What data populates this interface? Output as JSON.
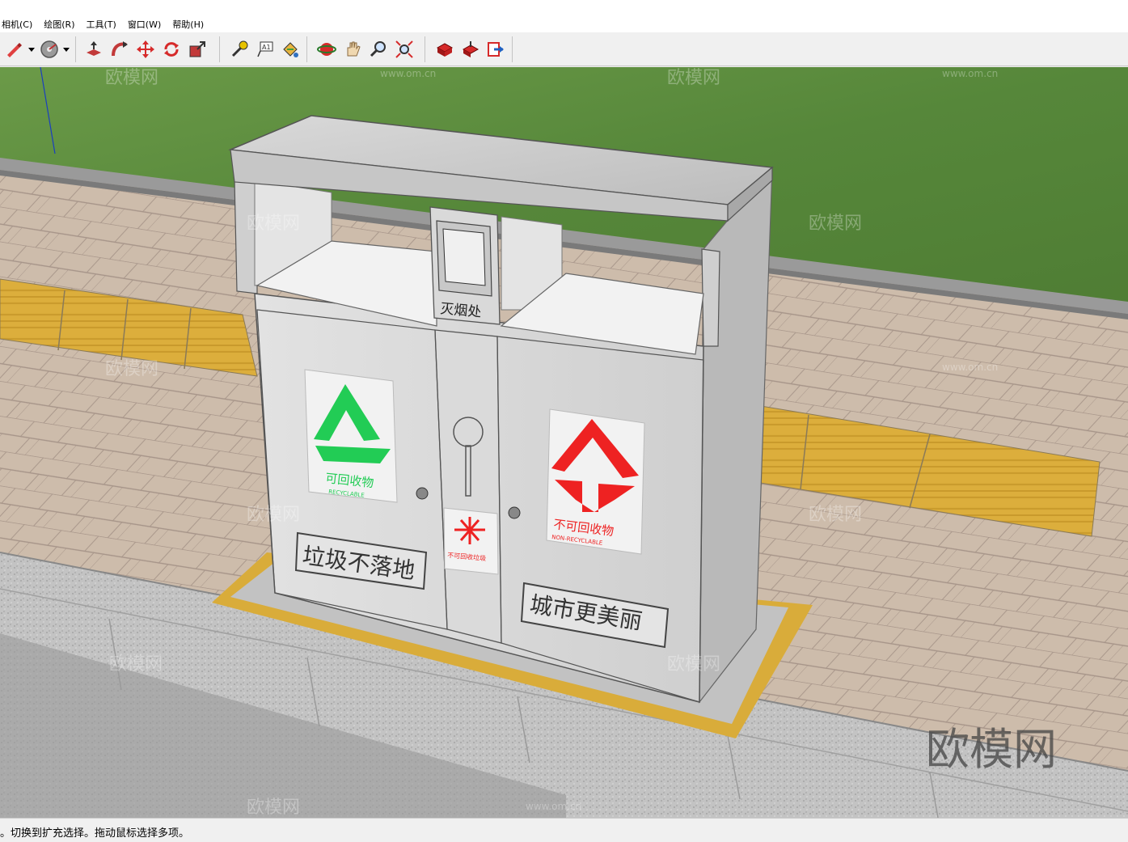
{
  "menu": {
    "items": [
      "相机(C)",
      "绘图(R)",
      "工具(T)",
      "窗口(W)",
      "帮助(H)"
    ]
  },
  "toolbar": {
    "groups": [
      [
        "pencil-icon",
        "dropdown-arrow",
        "disc-icon",
        "dropdown-arrow"
      ],
      [
        "push-pull-icon",
        "follow-me-icon",
        "move-icon",
        "rotate-icon",
        "scale-icon"
      ],
      [
        "tape-measure-icon",
        "text-icon",
        "paint-bucket-icon"
      ],
      [
        "orbit-icon",
        "pan-icon",
        "zoom-icon",
        "zoom-extents-icon"
      ],
      [
        "get-models-icon",
        "share-model-icon",
        "upload-icon"
      ]
    ]
  },
  "scene": {
    "bin": {
      "center_sign": "灭烟处",
      "left_panel": {
        "label": "可回收物",
        "label_en": "RECYCLABLE",
        "color": "#22cc55"
      },
      "right_panel": {
        "label": "不可回收物",
        "label_en": "NON-RECYCLABLE",
        "color": "#ee2222"
      },
      "middle_panel": {
        "label": "不可回收垃圾",
        "color": "#ee2222"
      },
      "left_slogan": "垃圾不落地",
      "right_slogan": "城市更美丽"
    },
    "watermark": "欧模网",
    "watermark_small": "www.om.cn"
  },
  "status": {
    "text": "。切换到扩充选择。拖动鼠标选择多项。"
  },
  "colors": {
    "grass": "#5a8a3c",
    "paving": "#c9b8a8",
    "tactile": "#d9ac3a",
    "curb": "#bfbfbf",
    "bin": "#d6d6d6"
  }
}
